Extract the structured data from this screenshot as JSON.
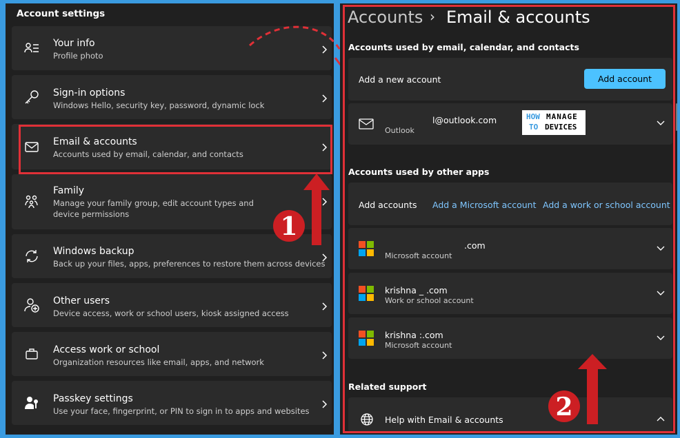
{
  "left": {
    "title": "Account settings",
    "items": [
      {
        "title": "Your info",
        "sub": "Profile photo",
        "icon": "person-list-icon"
      },
      {
        "title": "Sign-in options",
        "sub": "Windows Hello, security key, password, dynamic lock",
        "icon": "key-icon"
      },
      {
        "title": "Email & accounts",
        "sub": "Accounts used by email, calendar, and contacts",
        "icon": "mail-icon"
      },
      {
        "title": "Family",
        "sub": "Manage your family group, edit account types and device permissions",
        "icon": "family-icon"
      },
      {
        "title": "Windows backup",
        "sub": "Back up your files, apps, preferences to restore them across devices",
        "icon": "sync-icon"
      },
      {
        "title": "Other users",
        "sub": "Device access, work or school users, kiosk assigned access",
        "icon": "add-user-icon"
      },
      {
        "title": "Access work or school",
        "sub": "Organization resources like email, apps, and network",
        "icon": "briefcase-icon"
      },
      {
        "title": "Passkey settings",
        "sub": "Use your face, fingerprint, or PIN to sign in to apps and websites",
        "icon": "passkey-icon"
      }
    ]
  },
  "right": {
    "breadcrumb_parent": "Accounts",
    "breadcrumb_sep": "›",
    "breadcrumb_current": "Email & accounts",
    "section1_title": "Accounts used by email, calendar, and contacts",
    "add_new_label": "Add a new account",
    "add_button": "Add account",
    "email_account": {
      "address": "l@outlook.com",
      "type": "Outlook"
    },
    "section2_title": "Accounts used by other apps",
    "add_accounts_label": "Add accounts",
    "link_ms": "Add a Microsoft account",
    "link_work": "Add a work or school account",
    "accounts": [
      {
        "name": ".com",
        "type": "Microsoft account"
      },
      {
        "name": "krishna _                         .com",
        "type": "Work or school account"
      },
      {
        "name": "krishna                         :.com",
        "type": "Microsoft account"
      }
    ],
    "section3_title": "Related support",
    "help_label": "Help with Email & accounts"
  },
  "watermark": {
    "line1a": "HOW",
    "line1b": "MANAGE",
    "line2a": "TO",
    "line2b": "DEVICES"
  },
  "annotations": {
    "num1": "1",
    "num2": "2"
  },
  "colors": {
    "accent": "#4cc2ff",
    "link": "#7fc6ff",
    "highlight": "#e03037"
  }
}
